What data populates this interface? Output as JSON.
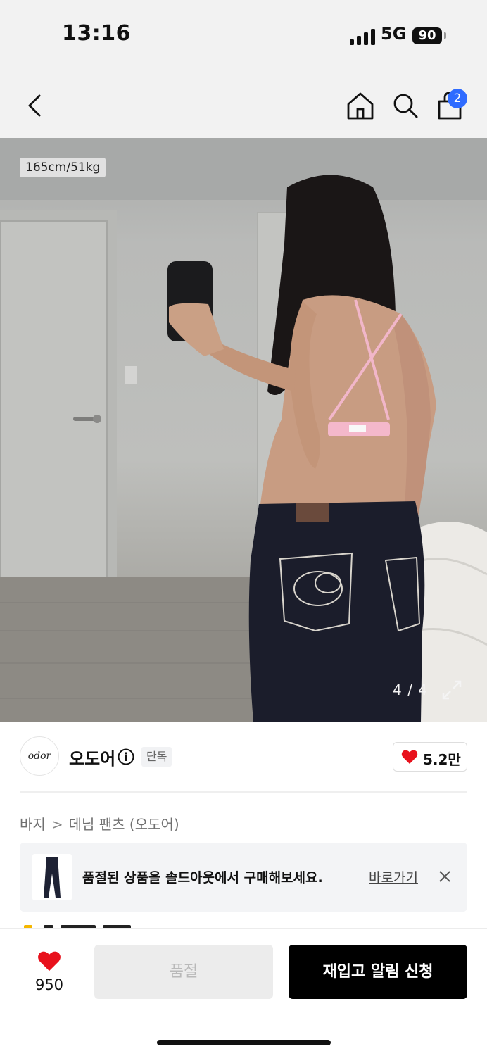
{
  "status_bar": {
    "time": "13:16",
    "network": "5G",
    "battery": "90"
  },
  "header": {
    "cart_count": "2"
  },
  "gallery": {
    "model_size": "165cm/51kg",
    "page_indicator": "4 / 4"
  },
  "brand": {
    "logo_text": "odor",
    "name": "오도어",
    "badge": "단독",
    "likes": "5.2만"
  },
  "breadcrumb": {
    "level1": "바지",
    "separator": ">",
    "level2": "데님 팬츠 (오도어)"
  },
  "soldout_banner": {
    "message": "품절된 상품을 솔드아웃에서 구매해보세요.",
    "link_label": "바로가기"
  },
  "bottom_bar": {
    "wish_count": "950",
    "soldout_label": "품절",
    "restock_label": "재입고 알림 신청"
  },
  "colors": {
    "accent_blue": "#2f6bff",
    "heart_red": "#e8111c",
    "primary_black": "#000000"
  }
}
